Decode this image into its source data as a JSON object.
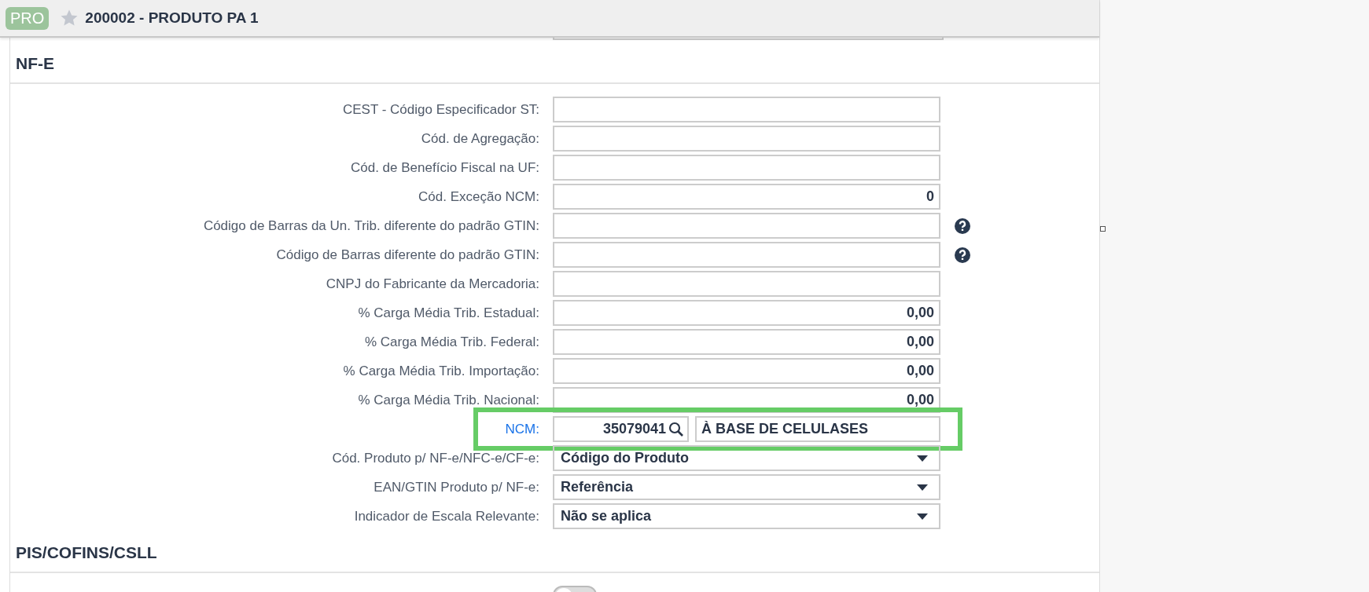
{
  "header": {
    "badge": "PRO",
    "favorite": false,
    "title": "200002 - PRODUTO PA 1"
  },
  "sections": [
    {
      "title": "NF-E",
      "fields": [
        {
          "kind": "text",
          "label": "CEST - Código Especificador ST:",
          "help": false
        },
        {
          "kind": "text",
          "label": "Cód. de Agregação:",
          "help": false
        },
        {
          "kind": "text",
          "label": "Cód. de Benefício Fiscal na UF:",
          "help": false
        },
        {
          "kind": "text",
          "label": "Cód. Exceção NCM:",
          "value": "0",
          "help": false
        },
        {
          "kind": "text",
          "label": "Código de Barras da Un. Trib. diferente do padrão GTIN:",
          "help": true
        },
        {
          "kind": "text",
          "label": "Código de Barras diferente do padrão GTIN:",
          "help": true
        },
        {
          "kind": "text",
          "label": "CNPJ do Fabricante da Mercadoria:",
          "help": false
        },
        {
          "kind": "text",
          "label": "% Carga Média Trib. Estadual:",
          "value": "0,00",
          "help": false
        },
        {
          "kind": "text",
          "label": "% Carga Média Trib. Federal:",
          "value": "0,00",
          "help": false
        },
        {
          "kind": "text",
          "label": "% Carga Média Trib. Importação:",
          "value": "0,00",
          "help": false
        },
        {
          "kind": "text",
          "label": "% Carga Média Trib. Nacional:",
          "value": "0,00",
          "help": false
        },
        {
          "kind": "lookup",
          "label": "NCM:",
          "value": "35079041",
          "description": "À BASE DE CELULASES",
          "highlighted": true
        },
        {
          "kind": "select",
          "label": "Cód. Produto p/ NF-e/NFC-e/CF-e:",
          "value": "Código do Produto"
        },
        {
          "kind": "select",
          "label": "EAN/GTIN Produto p/ NF-e:",
          "value": "Referência"
        },
        {
          "kind": "select",
          "label": "Indicador de Escala Relevante:",
          "value": "Não se aplica"
        }
      ]
    },
    {
      "title": "PIS/COFINS/CSLL",
      "toggle": {
        "on": false
      }
    }
  ]
}
